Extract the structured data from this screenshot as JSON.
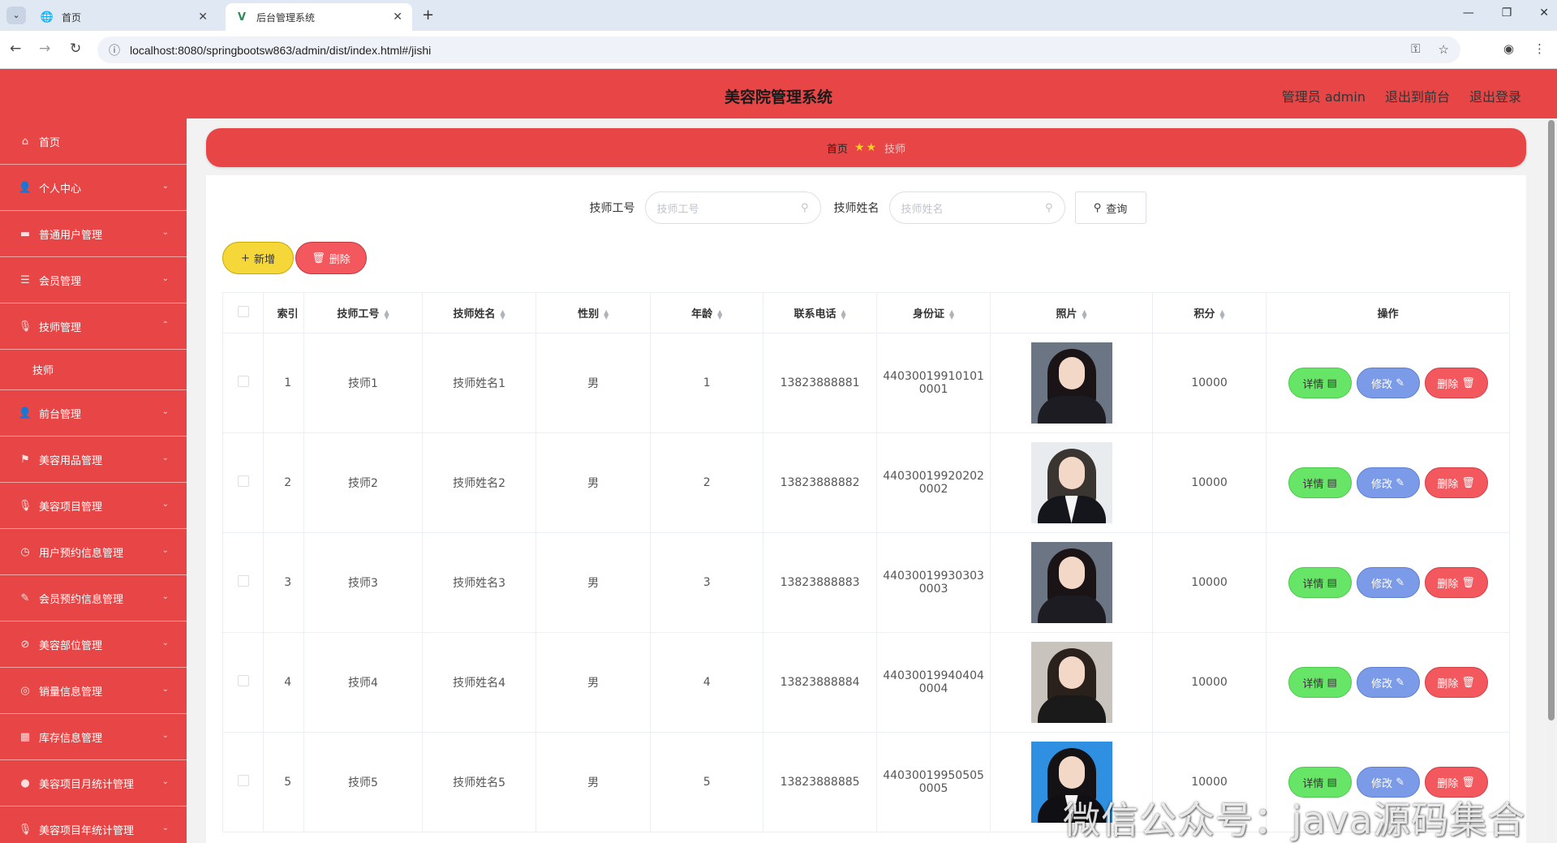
{
  "browser": {
    "tabs": [
      {
        "title": "首页",
        "icon": "globe-icon"
      },
      {
        "title": "后台管理系统",
        "icon": "vue-logo-icon"
      }
    ],
    "url": "localhost:8080/springbootsw863/admin/dist/index.html#/jishi"
  },
  "header": {
    "title": "美容院管理系统",
    "user_label": "管理员 admin",
    "to_front": "退出到前台",
    "logout": "退出登录"
  },
  "sidebar": {
    "items": [
      {
        "label": "首页",
        "icon": "home-icon"
      },
      {
        "label": "个人中心",
        "icon": "user-icon"
      },
      {
        "label": "普通用户管理",
        "icon": "monitor-icon"
      },
      {
        "label": "会员管理",
        "icon": "sliders-icon"
      },
      {
        "label": "技师管理",
        "icon": "mic-icon",
        "expanded": true
      },
      {
        "label": "技师",
        "sub": true
      },
      {
        "label": "前台管理",
        "icon": "user-icon"
      },
      {
        "label": "美容用品管理",
        "icon": "flag-icon"
      },
      {
        "label": "美容项目管理",
        "icon": "mic-icon"
      },
      {
        "label": "用户预约信息管理",
        "icon": "clock-icon"
      },
      {
        "label": "会员预约信息管理",
        "icon": "pen-icon"
      },
      {
        "label": "美容部位管理",
        "icon": "compass-icon"
      },
      {
        "label": "销量信息管理",
        "icon": "circle-icon"
      },
      {
        "label": "库存信息管理",
        "icon": "grid-icon"
      },
      {
        "label": "美容项目月统计管理",
        "icon": "location-icon"
      },
      {
        "label": "美容项目年统计管理",
        "icon": "mic-icon"
      }
    ]
  },
  "breadcrumb": {
    "home": "首页",
    "current": "技师"
  },
  "search": {
    "label_no": "技师工号",
    "placeholder_no": "技师工号",
    "label_name": "技师姓名",
    "placeholder_name": "技师姓名",
    "query": "查询"
  },
  "actions": {
    "add": "新增",
    "delete": "删除"
  },
  "table": {
    "headers": [
      "索引",
      "技师工号",
      "技师姓名",
      "性别",
      "年龄",
      "联系电话",
      "身份证",
      "照片",
      "积分",
      "操作"
    ],
    "ops": {
      "detail": "详情",
      "edit": "修改",
      "delete": "删除"
    },
    "rows": [
      {
        "index": "1",
        "no": "技师1",
        "name": "技师姓名1",
        "gender": "男",
        "age": "1",
        "phone": "13823888881",
        "id_a": "44030019910101",
        "id_b": "0001",
        "points": "10000",
        "photo": "woman-dark"
      },
      {
        "index": "2",
        "no": "技师2",
        "name": "技师姓名2",
        "gender": "男",
        "age": "2",
        "phone": "13823888882",
        "id_a": "44030019920202",
        "id_b": "0002",
        "points": "10000",
        "photo": "man-suit"
      },
      {
        "index": "3",
        "no": "技师3",
        "name": "技师姓名3",
        "gender": "男",
        "age": "3",
        "phone": "13823888883",
        "id_a": "44030019930303",
        "id_b": "0003",
        "points": "10000",
        "photo": "woman-dark"
      },
      {
        "index": "4",
        "no": "技师4",
        "name": "技师姓名4",
        "gender": "男",
        "age": "4",
        "phone": "13823888884",
        "id_a": "44030019940404",
        "id_b": "0004",
        "points": "10000",
        "photo": "woman-outdoor"
      },
      {
        "index": "5",
        "no": "技师5",
        "name": "技师姓名5",
        "gender": "男",
        "age": "5",
        "phone": "13823888885",
        "id_a": "44030019950505",
        "id_b": "0005",
        "points": "10000",
        "photo": "woman-blue"
      }
    ]
  },
  "watermark": "微信公众号：java源码集合"
}
